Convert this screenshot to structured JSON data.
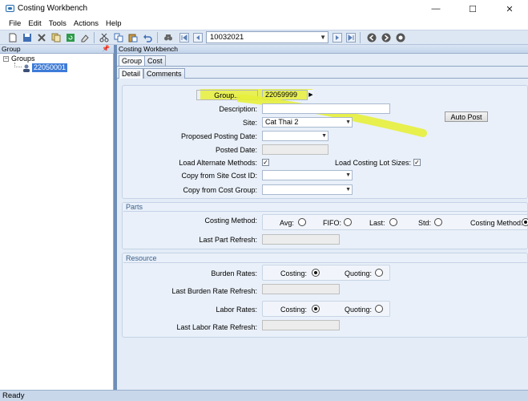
{
  "window": {
    "title": "Costing Workbench",
    "minimize": "—",
    "maximize": "☐",
    "close": "✕"
  },
  "menu": [
    "File",
    "Edit",
    "Tools",
    "Actions",
    "Help"
  ],
  "toolbar": {
    "record_value": "10032021"
  },
  "left_panel": {
    "title": "Group",
    "pin": "📌",
    "tree": {
      "root_label": "Groups",
      "child_label": "22050001",
      "expander": "−"
    }
  },
  "right_panel": {
    "title": "Costing Workbench",
    "main_tabs": [
      "Group",
      "Cost"
    ],
    "sub_tabs": [
      "Detail",
      "Comments"
    ]
  },
  "form": {
    "group_button": "Group...",
    "group_value": "22059999",
    "description_label": "Description:",
    "description_value": "",
    "site_label": "Site:",
    "site_value": "Cat Thai 2",
    "proposed_posting_date_label": "Proposed Posting Date:",
    "posted_date_label": "Posted Date:",
    "load_alternate_methods_label": "Load Alternate Methods:",
    "load_alternate_methods_checked": true,
    "load_costing_lot_sizes_label": "Load Costing Lot Sizes:",
    "load_costing_lot_sizes_checked": true,
    "copy_site_cost_label": "Copy from Site Cost ID:",
    "copy_cost_group_label": "Copy from Cost Group:",
    "auto_post_button": "Auto Post",
    "check_mark": "✓"
  },
  "parts": {
    "title": "Parts",
    "costing_method_label": "Costing Method:",
    "options": [
      "Avg:",
      "FIFO:",
      "Last:",
      "Std:",
      "Costing Method:"
    ],
    "selected_index": 4,
    "last_part_refresh_label": "Last Part Refresh:"
  },
  "resource": {
    "title": "Resource",
    "burden_rates_label": "Burden Rates:",
    "burden_options": [
      "Costing:",
      "Quoting:"
    ],
    "burden_selected_index": 0,
    "last_burden_refresh_label": "Last Burden Rate Refresh:",
    "labor_rates_label": "Labor Rates:",
    "labor_options": [
      "Costing:",
      "Quoting:"
    ],
    "labor_selected_index": 0,
    "last_labor_refresh_label": "Last Labor Rate Refresh:"
  },
  "status": {
    "text": "Ready"
  },
  "colors": {
    "highlight": "#e7f03a",
    "selection": "#3d7bd8",
    "accent": "#6d8eb8"
  }
}
